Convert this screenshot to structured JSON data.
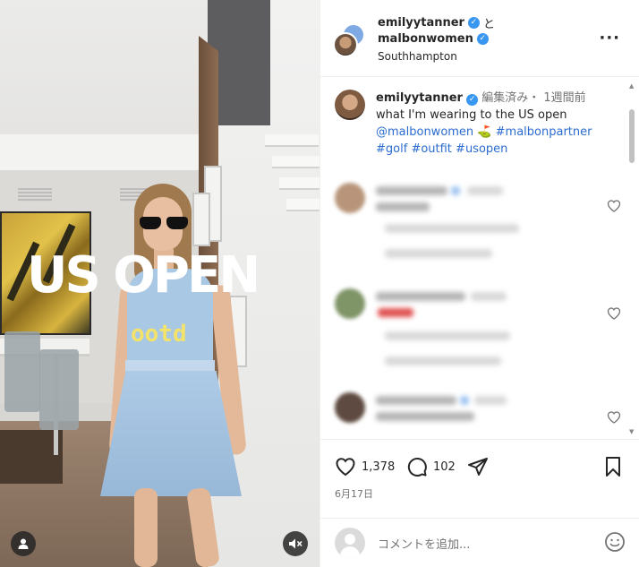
{
  "media": {
    "overlay_title": "US OPEN",
    "overlay_subtitle": "ootd",
    "tagged_user_icon": "person-icon",
    "mute_icon": "speaker-muted-icon"
  },
  "header": {
    "user1": "emilyytanner",
    "conjunction": "と",
    "user2": "malbonwomen",
    "location": "Southhampton",
    "more_icon": "more-options-icon",
    "more_label": "···"
  },
  "caption": {
    "username": "emilyytanner",
    "meta": "編集済み・ 1週間前",
    "line1": "what I'm wearing to the US open",
    "mention": "@malbonwomen",
    "emoji": "⛳",
    "tag1": "#malbonpartner",
    "tag2": "#golf",
    "tag3": "#outfit",
    "tag4": "#usopen"
  },
  "actions": {
    "likes": "1,378",
    "comments": "102",
    "date": "6月17日"
  },
  "add_comment": {
    "placeholder": "コメントを追加..."
  },
  "colors": {
    "verified": "#3897f0",
    "hashtag": "#2b6cd1",
    "overlay_sub": "#f3e36a"
  }
}
